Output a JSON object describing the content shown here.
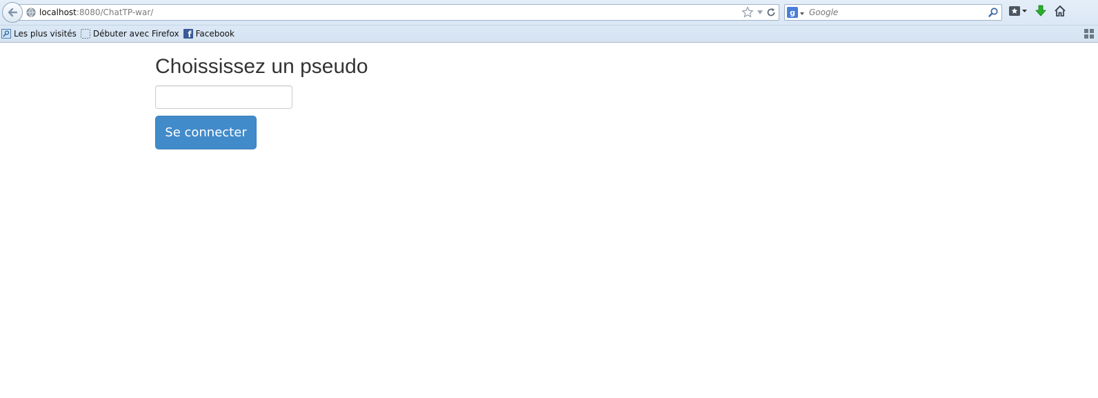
{
  "browser": {
    "url_host": "localhost",
    "url_rest": ":8080/ChatTP-war/",
    "search_placeholder": "Google",
    "bookmarks": [
      {
        "label": "Les plus visités",
        "icon": "most-visited-icon"
      },
      {
        "label": "Débuter avec Firefox",
        "icon": "blank-page-icon"
      },
      {
        "label": "Facebook",
        "icon": "facebook-icon"
      }
    ]
  },
  "page": {
    "title": "Choississez un pseudo",
    "input_value": "",
    "button_label": "Se connecter"
  },
  "colors": {
    "button_bg": "#428bca",
    "button_text": "#ffffff",
    "title_text": "#333333"
  }
}
